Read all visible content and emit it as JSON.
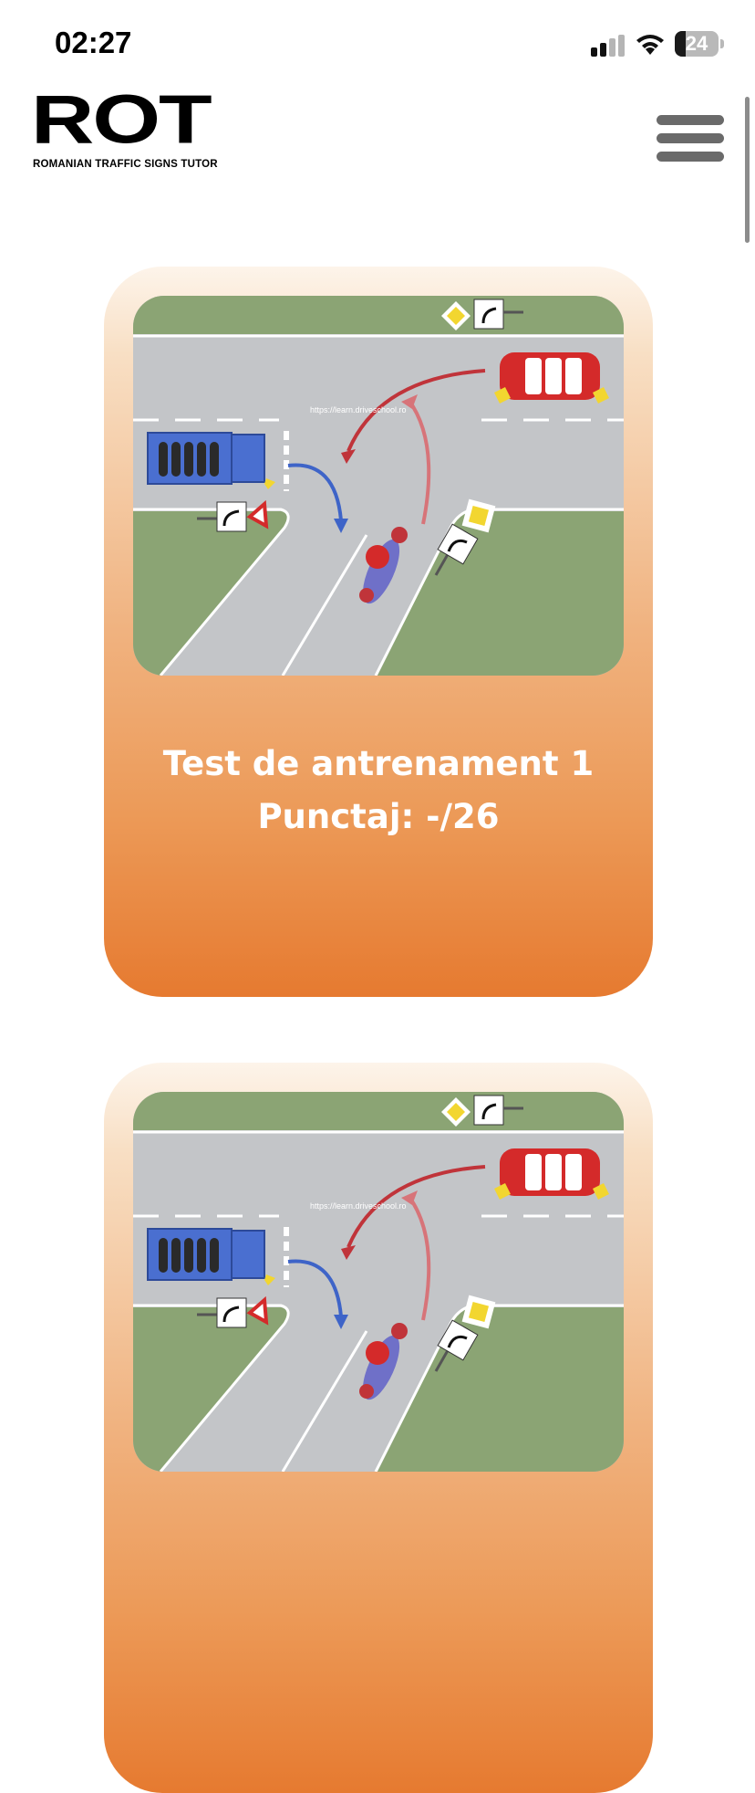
{
  "status_bar": {
    "time": "02:27",
    "battery_level": "24",
    "icons": [
      "signal-icon",
      "wifi-icon",
      "battery-icon"
    ]
  },
  "header": {
    "logo_text": "ROT",
    "logo_subtitle": "ROMANIAN TRAFFIC SIGNS TUTOR",
    "menu_icon": "hamburger-menu-icon"
  },
  "tests": [
    {
      "title": "Test de antrenament 1",
      "score": "Punctaj: -/26",
      "image_watermark": "https://learn.driveschool.ro"
    },
    {
      "title": "",
      "score": "",
      "image_watermark": "https://learn.driveschool.ro"
    }
  ],
  "colors": {
    "card_gradient_top": "#fdf4ea",
    "card_gradient_bottom": "#e67a30",
    "grass": "#8ba474",
    "road": "#c3c5c8",
    "car_red": "#d42a2a",
    "truck_blue": "#4a6fd0"
  }
}
